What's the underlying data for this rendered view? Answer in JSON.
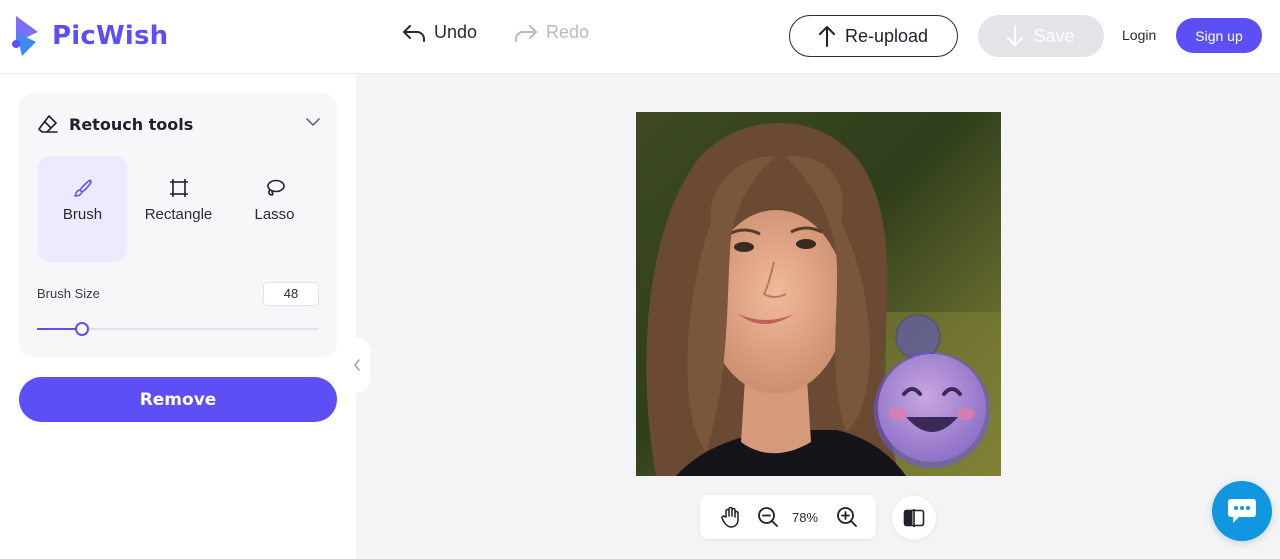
{
  "app": {
    "name": "PicWish",
    "brand_color": "#5b4ff5"
  },
  "header": {
    "undo_label": "Undo",
    "redo_label": "Redo",
    "reupload_label": "Re-upload",
    "save_label": "Save",
    "login_label": "Login",
    "signup_label": "Sign up"
  },
  "sidebar": {
    "panel_title": "Retouch tools",
    "tools": [
      {
        "label": "Brush",
        "icon": "brush-icon",
        "active": true
      },
      {
        "label": "Rectangle",
        "icon": "rectangle-icon",
        "active": false
      },
      {
        "label": "Lasso",
        "icon": "lasso-icon",
        "active": false
      }
    ],
    "brush_size_label": "Brush Size",
    "brush_size_value": "48",
    "brush_size_fraction": 0.16,
    "remove_label": "Remove"
  },
  "canvas": {
    "zoom_level": "78%",
    "image_subject": "portrait of a smiling woman with long wavy brown hair; a smiling-face emoji overlays the lower right, highlighted by purple brush strokes"
  },
  "icons": {
    "hand": "hand-icon",
    "zoom_out": "zoom-out-icon",
    "zoom_in": "zoom-in-icon",
    "compare": "compare-icon",
    "chat": "chat-icon"
  }
}
